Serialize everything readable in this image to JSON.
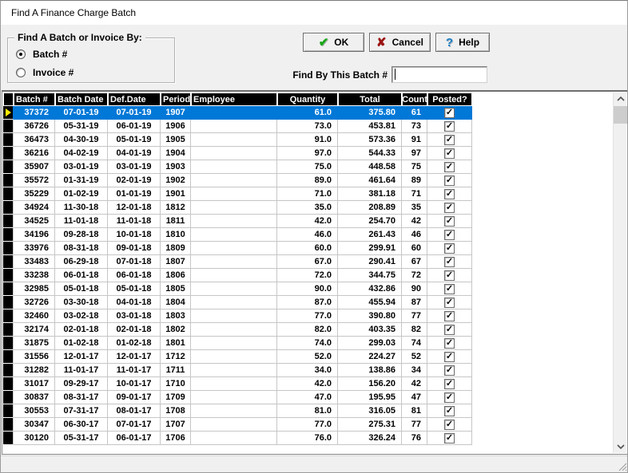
{
  "window": {
    "title": "Find A Finance Charge Batch"
  },
  "finder": {
    "group_caption": "Find A Batch or Invoice By:",
    "radios": [
      {
        "label": "Batch #",
        "selected": true
      },
      {
        "label": "Invoice #",
        "selected": false
      }
    ],
    "find_label": "Find By This Batch #",
    "find_value": ""
  },
  "toolbar": {
    "ok_label": "OK",
    "ok_icon": "✔",
    "cancel_label": "Cancel",
    "cancel_icon": "✘",
    "help_label": "Help",
    "help_icon": "?"
  },
  "table": {
    "columns": [
      "Batch #",
      "Batch Date",
      "Def.Date",
      "Period",
      "Employee",
      "Quantity",
      "Total",
      "Count",
      "Posted?"
    ],
    "check_glyph": "✓",
    "selected_index": 0,
    "rows": [
      [
        "37372",
        "07-01-19",
        "07-01-19",
        "1907",
        "",
        "61.0",
        "375.80",
        "61",
        true
      ],
      [
        "36726",
        "05-31-19",
        "06-01-19",
        "1906",
        "",
        "73.0",
        "453.81",
        "73",
        true
      ],
      [
        "36473",
        "04-30-19",
        "05-01-19",
        "1905",
        "",
        "91.0",
        "573.36",
        "91",
        true
      ],
      [
        "36216",
        "04-02-19",
        "04-01-19",
        "1904",
        "",
        "97.0",
        "544.33",
        "97",
        true
      ],
      [
        "35907",
        "03-01-19",
        "03-01-19",
        "1903",
        "",
        "75.0",
        "448.58",
        "75",
        true
      ],
      [
        "35572",
        "01-31-19",
        "02-01-19",
        "1902",
        "",
        "89.0",
        "461.64",
        "89",
        true
      ],
      [
        "35229",
        "01-02-19",
        "01-01-19",
        "1901",
        "",
        "71.0",
        "381.18",
        "71",
        true
      ],
      [
        "34924",
        "11-30-18",
        "12-01-18",
        "1812",
        "",
        "35.0",
        "208.89",
        "35",
        true
      ],
      [
        "34525",
        "11-01-18",
        "11-01-18",
        "1811",
        "",
        "42.0",
        "254.70",
        "42",
        true
      ],
      [
        "34196",
        "09-28-18",
        "10-01-18",
        "1810",
        "",
        "46.0",
        "261.43",
        "46",
        true
      ],
      [
        "33976",
        "08-31-18",
        "09-01-18",
        "1809",
        "",
        "60.0",
        "299.91",
        "60",
        true
      ],
      [
        "33483",
        "06-29-18",
        "07-01-18",
        "1807",
        "",
        "67.0",
        "290.41",
        "67",
        true
      ],
      [
        "33238",
        "06-01-18",
        "06-01-18",
        "1806",
        "",
        "72.0",
        "344.75",
        "72",
        true
      ],
      [
        "32985",
        "05-01-18",
        "05-01-18",
        "1805",
        "",
        "90.0",
        "432.86",
        "90",
        true
      ],
      [
        "32726",
        "03-30-18",
        "04-01-18",
        "1804",
        "",
        "87.0",
        "455.94",
        "87",
        true
      ],
      [
        "32460",
        "03-02-18",
        "03-01-18",
        "1803",
        "",
        "77.0",
        "390.80",
        "77",
        true
      ],
      [
        "32174",
        "02-01-18",
        "02-01-18",
        "1802",
        "",
        "82.0",
        "403.35",
        "82",
        true
      ],
      [
        "31875",
        "01-02-18",
        "01-02-18",
        "1801",
        "",
        "74.0",
        "299.03",
        "74",
        true
      ],
      [
        "31556",
        "12-01-17",
        "12-01-17",
        "1712",
        "",
        "52.0",
        "224.27",
        "52",
        true
      ],
      [
        "31282",
        "11-01-17",
        "11-01-17",
        "1711",
        "",
        "34.0",
        "138.86",
        "34",
        true
      ],
      [
        "31017",
        "09-29-17",
        "10-01-17",
        "1710",
        "",
        "42.0",
        "156.20",
        "42",
        true
      ],
      [
        "30837",
        "08-31-17",
        "09-01-17",
        "1709",
        "",
        "47.0",
        "195.95",
        "47",
        true
      ],
      [
        "30553",
        "07-31-17",
        "08-01-17",
        "1708",
        "",
        "81.0",
        "316.05",
        "81",
        true
      ],
      [
        "30347",
        "06-30-17",
        "07-01-17",
        "1707",
        "",
        "77.0",
        "275.31",
        "77",
        true
      ],
      [
        "30120",
        "05-31-17",
        "06-01-17",
        "1706",
        "",
        "76.0",
        "326.24",
        "76",
        true
      ]
    ]
  },
  "colors": {
    "selection_blue": "#0078d7",
    "header_bg": "#000000",
    "indicator_yellow": "#ffe900",
    "ok_green": "#17a517",
    "cancel_red": "#9b1412",
    "help_blue": "#1b7fc4",
    "dialog_bg": "#f0f0f0"
  }
}
